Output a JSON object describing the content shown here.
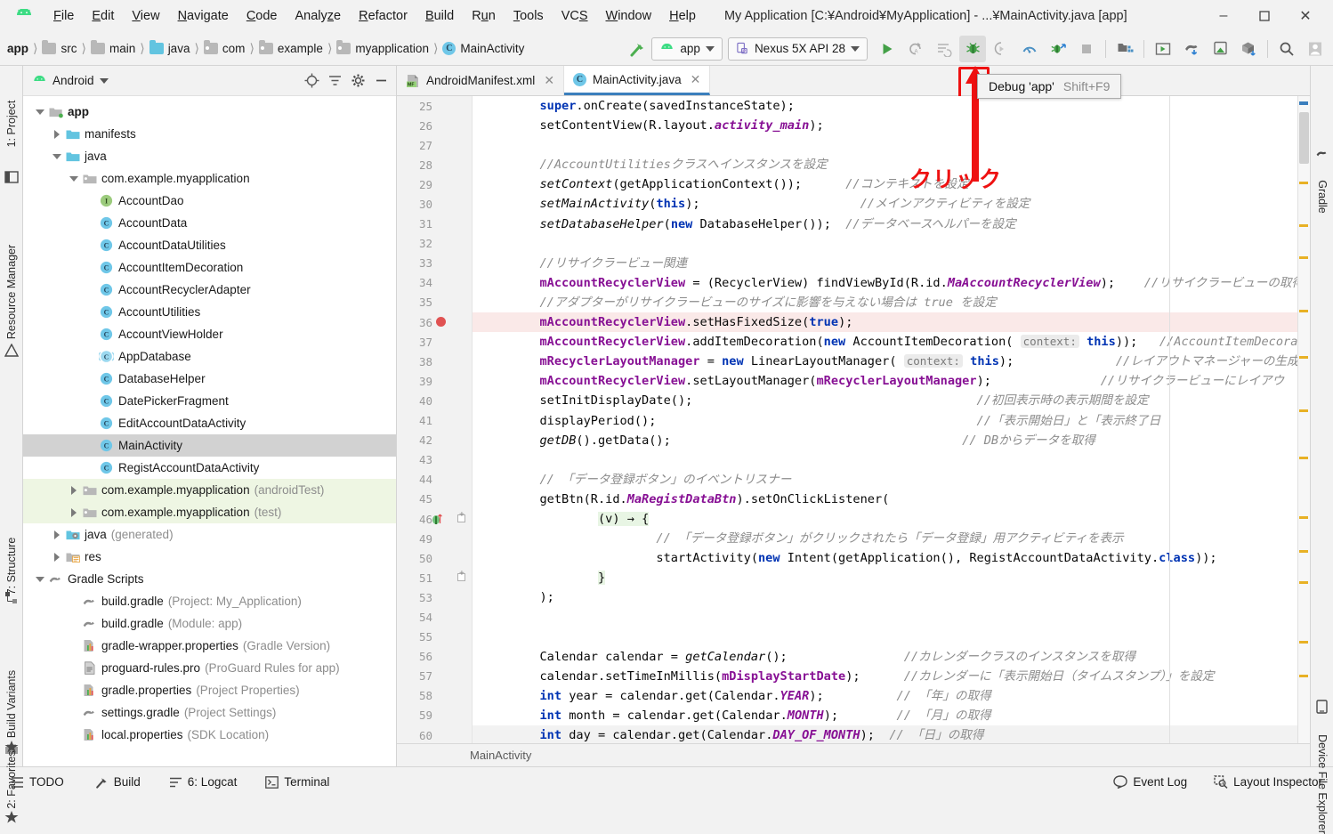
{
  "window": {
    "title": "My Application [C:¥Android¥MyApplication] - ...¥MainActivity.java [app]",
    "logo_icon": "android-logo-icon",
    "minimize_label": "–",
    "maximize_label": "❐",
    "close_label": "✕"
  },
  "menu": [
    {
      "label": "File",
      "mnemonic": "F"
    },
    {
      "label": "Edit",
      "mnemonic": "E"
    },
    {
      "label": "View",
      "mnemonic": "V"
    },
    {
      "label": "Navigate",
      "mnemonic": "N"
    },
    {
      "label": "Code",
      "mnemonic": "C"
    },
    {
      "label": "Analyze",
      "mnemonic": "z"
    },
    {
      "label": "Refactor",
      "mnemonic": "R"
    },
    {
      "label": "Build",
      "mnemonic": "B"
    },
    {
      "label": "Run",
      "mnemonic": "u"
    },
    {
      "label": "Tools",
      "mnemonic": "T"
    },
    {
      "label": "VCS",
      "mnemonic": "S"
    },
    {
      "label": "Window",
      "mnemonic": "W"
    },
    {
      "label": "Help",
      "mnemonic": "H"
    }
  ],
  "breadcrumbs": [
    {
      "label": "app",
      "icon": "module-icon",
      "bold": true
    },
    {
      "label": "src",
      "icon": "folder-gray-icon"
    },
    {
      "label": "main",
      "icon": "folder-gray-icon"
    },
    {
      "label": "java",
      "icon": "folder-blue-icon"
    },
    {
      "label": "com",
      "icon": "package-icon"
    },
    {
      "label": "example",
      "icon": "package-icon"
    },
    {
      "label": "myapplication",
      "icon": "package-icon"
    },
    {
      "label": "MainActivity",
      "icon": "class-icon"
    }
  ],
  "toolbar": {
    "make_icon": "hammer-icon",
    "run_config": {
      "label": "app",
      "icon": "android-head-icon",
      "caret": "▼"
    },
    "device": {
      "label": "Nexus 5X API 28",
      "icon": "device-icon",
      "caret": "▼"
    },
    "buttons": [
      {
        "name": "run-button",
        "icon": "play-icon"
      },
      {
        "name": "rerun-button",
        "icon": "rerun-icon"
      },
      {
        "name": "apply-changes-button",
        "icon": "apply-changes-icon"
      },
      {
        "name": "debug-button",
        "icon": "debug-bug-icon",
        "highlighted": true
      },
      {
        "name": "attach-debugger-button",
        "icon": "attach-debugger-icon"
      },
      {
        "name": "profiler-button",
        "icon": "profiler-icon"
      },
      {
        "name": "stop-debug-button",
        "icon": "stop-debug-icon"
      },
      {
        "name": "stop-button",
        "icon": "stop-square-icon"
      },
      {
        "name": "sdk-manager-button",
        "icon": "sdk-manager-icon"
      },
      {
        "name": "avd-manager-button",
        "icon": "avd-manager-icon"
      },
      {
        "name": "sync-gradle-button",
        "icon": "elephant-sync-icon"
      },
      {
        "name": "layout-inspector-button",
        "icon": "device-layout-icon"
      },
      {
        "name": "project-structure-button",
        "icon": "project-structure-icon"
      },
      {
        "name": "search-button",
        "icon": "search-icon"
      },
      {
        "name": "account-button",
        "icon": "avatar-icon"
      }
    ]
  },
  "tooltip": {
    "label": "Debug 'app'",
    "shortcut": "Shift+F9"
  },
  "annotation": {
    "arrow_color": "#ee1111",
    "highlight_color": "#ee1111",
    "inline_text": "クリック"
  },
  "left_strips": [
    {
      "label": "1: Project",
      "icon": "project-icon"
    },
    {
      "label": "Resource Manager",
      "icon": "resource-manager-icon"
    },
    {
      "label": "7: Structure",
      "icon": "structure-icon"
    },
    {
      "label": "Build Variants",
      "icon": "build-variants-icon"
    },
    {
      "label": "2: Favorites",
      "icon": "favorites-star-icon"
    }
  ],
  "right_strips": [
    {
      "label": "Gradle",
      "icon": "gradle-elephant-icon"
    },
    {
      "label": "Device File Explorer",
      "icon": "device-file-explorer-icon"
    }
  ],
  "project_panel": {
    "title": "Android",
    "title_icon": "android-head-icon",
    "title_caret": "▼",
    "actions": [
      {
        "name": "select-opened-file-button",
        "icon": "target-icon"
      },
      {
        "name": "collapse-all-button",
        "icon": "collapse-all-icon"
      },
      {
        "name": "settings-button",
        "icon": "gear-icon"
      },
      {
        "name": "hide-button",
        "icon": "minus-icon"
      }
    ],
    "tree": [
      {
        "label": "app",
        "indent": 0,
        "twist": "down",
        "icon": "module-icon",
        "bold": true
      },
      {
        "label": "manifests",
        "indent": 1,
        "twist": "right",
        "icon": "folder-blue-icon"
      },
      {
        "label": "java",
        "indent": 1,
        "twist": "down",
        "icon": "folder-blue-icon"
      },
      {
        "label": "com.example.myapplication",
        "indent": 2,
        "twist": "down",
        "icon": "package-icon"
      },
      {
        "label": "AccountDao",
        "indent": 3,
        "twist": "none",
        "icon": "interface-icon"
      },
      {
        "label": "AccountData",
        "indent": 3,
        "twist": "none",
        "icon": "class-icon"
      },
      {
        "label": "AccountDataUtilities",
        "indent": 3,
        "twist": "none",
        "icon": "class-icon"
      },
      {
        "label": "AccountItemDecoration",
        "indent": 3,
        "twist": "none",
        "icon": "class-icon"
      },
      {
        "label": "AccountRecyclerAdapter",
        "indent": 3,
        "twist": "none",
        "icon": "class-icon"
      },
      {
        "label": "AccountUtilities",
        "indent": 3,
        "twist": "none",
        "icon": "class-icon"
      },
      {
        "label": "AccountViewHolder",
        "indent": 3,
        "twist": "none",
        "icon": "class-icon"
      },
      {
        "label": "AppDatabase",
        "indent": 3,
        "twist": "none",
        "icon": "abstract-class-icon"
      },
      {
        "label": "DatabaseHelper",
        "indent": 3,
        "twist": "none",
        "icon": "class-icon"
      },
      {
        "label": "DatePickerFragment",
        "indent": 3,
        "twist": "none",
        "icon": "class-icon"
      },
      {
        "label": "EditAccountDataActivity",
        "indent": 3,
        "twist": "none",
        "icon": "class-icon"
      },
      {
        "label": "MainActivity",
        "indent": 3,
        "twist": "none",
        "icon": "class-icon",
        "selected": true
      },
      {
        "label": "RegistAccountDataActivity",
        "indent": 3,
        "twist": "none",
        "icon": "class-icon"
      },
      {
        "label": "com.example.myapplication",
        "suffix": "(androidTest)",
        "indent": 2,
        "twist": "right",
        "icon": "package-icon",
        "testgroup": true
      },
      {
        "label": "com.example.myapplication",
        "suffix": "(test)",
        "indent": 2,
        "twist": "right",
        "icon": "package-icon",
        "testgroup": true
      },
      {
        "label": "java",
        "suffix": "(generated)",
        "indent": 1,
        "twist": "right",
        "icon": "folder-generated-icon"
      },
      {
        "label": "res",
        "indent": 1,
        "twist": "right",
        "icon": "folder-res-icon"
      },
      {
        "label": "Gradle Scripts",
        "indent": 0,
        "twist": "down",
        "icon": "gradle-elephant-icon"
      },
      {
        "label": "build.gradle",
        "suffix": "(Project: My_Application)",
        "indent": 2,
        "twist": "none",
        "icon": "gradle-elephant-icon"
      },
      {
        "label": "build.gradle",
        "suffix": "(Module: app)",
        "indent": 2,
        "twist": "none",
        "icon": "gradle-elephant-icon"
      },
      {
        "label": "gradle-wrapper.properties",
        "suffix": "(Gradle Version)",
        "indent": 2,
        "twist": "none",
        "icon": "properties-icon"
      },
      {
        "label": "proguard-rules.pro",
        "suffix": "(ProGuard Rules for app)",
        "indent": 2,
        "twist": "none",
        "icon": "text-file-icon"
      },
      {
        "label": "gradle.properties",
        "suffix": "(Project Properties)",
        "indent": 2,
        "twist": "none",
        "icon": "properties-icon"
      },
      {
        "label": "settings.gradle",
        "suffix": "(Project Settings)",
        "indent": 2,
        "twist": "none",
        "icon": "gradle-elephant-icon"
      },
      {
        "label": "local.properties",
        "suffix": "(SDK Location)",
        "indent": 2,
        "twist": "none",
        "icon": "properties-icon"
      }
    ]
  },
  "editor": {
    "tabs": [
      {
        "label": "AndroidManifest.xml",
        "icon": "manifest-icon",
        "active": false,
        "close": "✕"
      },
      {
        "label": "MainActivity.java",
        "icon": "class-icon",
        "active": true,
        "close": "✕"
      }
    ],
    "status_breadcrumb": "MainActivity",
    "lines": [
      {
        "num": "25",
        "html": "        <b class='kw'>super</b>.onCreate(savedInstanceState);"
      },
      {
        "num": "26",
        "html": "        setContentView(R.layout.<i class='sfld'>activity_main</i>);"
      },
      {
        "num": "27",
        "html": ""
      },
      {
        "num": "28",
        "html": "        <i class='cmt'>//AccountUtilitiesクラスへインスタンスを設定</i>"
      },
      {
        "num": "29",
        "html": "        <i class='mth'>setContext</i>(getApplicationContext());      <i class='cmt'>//コンテキストを設定</i>"
      },
      {
        "num": "30",
        "html": "        <i class='mth'>setMainActivity</i>(<b class='kw'>this</b>);                      <i class='cmt'>//メインアクティビティを設定</i>"
      },
      {
        "num": "31",
        "html": "        <i class='mth'>setDatabaseHelper</i>(<b class='kw'>new</b> DatabaseHelper());  <i class='cmt'>//データベースヘルパーを設定</i>"
      },
      {
        "num": "32",
        "html": ""
      },
      {
        "num": "33",
        "html": "        <i class='cmt'>//リサイクラービュー関連</i>"
      },
      {
        "num": "34",
        "html": "        <b class='fld'>mAccountRecyclerView</b> = (RecyclerView) findViewById(R.id.<i class='sfld'>MaAccountRecyclerView</i>);    <i class='cmt'>//リサイクラービューの取得</i>"
      },
      {
        "num": "35",
        "html": "        <i class='cmt'>//アダプターがリサイクラービューのサイズに影響を与えない場合は true を設定</i>"
      },
      {
        "num": "36",
        "html": "        <b class='fld'>mAccountRecyclerView</b>.setHasFixedSize(<b class='kw'>true</b>);",
        "breakpoint": true
      },
      {
        "num": "37",
        "html": "        <b class='fld'>mAccountRecyclerView</b>.addItemDecoration(<b class='kw'>new</b> AccountItemDecoration( <span class='hint'>context:</span> <b class='kw'>this</b>));   <i class='cmt'>//AccountItemDecoration（表示</i>"
      },
      {
        "num": "38",
        "html": "        <b class='fld'>mRecyclerLayoutManager</b> = <b class='kw'>new</b> LinearLayoutManager( <span class='hint'>context:</span> <b class='kw'>this</b>);              <i class='cmt'>//レイアウトマネージャーの生成</i>"
      },
      {
        "num": "39",
        "html": "        <b class='fld'>mAccountRecyclerView</b>.setLayoutManager(<b class='fld'>mRecyclerLayoutManager</b>);               <i class='cmt'>//リサイクラービューにレイアウ</i>"
      },
      {
        "num": "40",
        "html": "        setInitDisplayDate();                                       <i class='cmt'>//初回表示時の表示期間を設定</i>"
      },
      {
        "num": "41",
        "html": "        displayPeriod();                                            <i class='cmt'>//「表示開始日」と「表示終了日</i>"
      },
      {
        "num": "42",
        "html": "        <i class='mth'>getDB</i>().getData();                                        <i class='cmt'>// DBからデータを取得</i>"
      },
      {
        "num": "43",
        "html": ""
      },
      {
        "num": "44",
        "html": "        <i class='cmt'>// 「データ登録ボタン」のイベントリスナー</i>"
      },
      {
        "num": "45",
        "html": "        getBtn(R.id.<i class='sfld'>MaRegistDataBtn</i>).setOnClickListener("
      },
      {
        "num": "46",
        "html": "                <span class='lam'>(v) → {</span>",
        "lambda": true,
        "fold": true
      },
      {
        "num": "49",
        "html": "                        <i class='cmt'>// 「データ登録ボタン」がクリックされたら「データ登録」用アクティビティを表示</i>"
      },
      {
        "num": "50",
        "html": "                        startActivity(<b class='kw'>new</b> Intent(getApplication(), RegistAccountDataActivity.<b class='kw'>class</b>));"
      },
      {
        "num": "51",
        "html": "                <span class='lam'>}</span>",
        "fold": true
      },
      {
        "num": "53",
        "html": "        );"
      },
      {
        "num": "54",
        "html": ""
      },
      {
        "num": "55",
        "html": ""
      },
      {
        "num": "56",
        "html": "        Calendar calendar = <i class='mth'>getCalendar</i>();                <i class='cmt'>//カレンダークラスのインスタンスを取得</i>"
      },
      {
        "num": "57",
        "html": "        calendar.setTimeInMillis(<b class='fld'>mDisplayStartDate</b>);      <i class='cmt'>//カレンダーに「表示開始日（タイムスタンプ）」を設定</i>"
      },
      {
        "num": "58",
        "html": "        <b class='kw'>int</b> year = calendar.get(Calendar.<i class='sfld'>YEAR</i>);          <i class='cmt'>// 「年」の取得</i>"
      },
      {
        "num": "59",
        "html": "        <b class='kw'>int</b> month = calendar.get(Calendar.<i class='sfld'>MONTH</i>);        <i class='cmt'>// 「月」の取得</i>"
      },
      {
        "num": "60",
        "html": "        <b class='kw'>int</b> day = calendar.get(Calendar.<i class='sfld'>DAY_OF_MONTH</i>);  <i class='cmt'>// 「日」の取得</i>",
        "current": true
      }
    ]
  },
  "statusbar": {
    "left": [
      {
        "label": "TODO",
        "icon": "todo-icon"
      },
      {
        "label": "Build",
        "icon": "hammer-icon"
      },
      {
        "label": "6: Logcat",
        "icon": "logcat-icon"
      },
      {
        "label": "Terminal",
        "icon": "terminal-icon"
      }
    ],
    "right": [
      {
        "label": "Event Log",
        "icon": "event-log-icon"
      },
      {
        "label": "Layout Inspector",
        "icon": "layout-inspector-icon"
      }
    ]
  }
}
